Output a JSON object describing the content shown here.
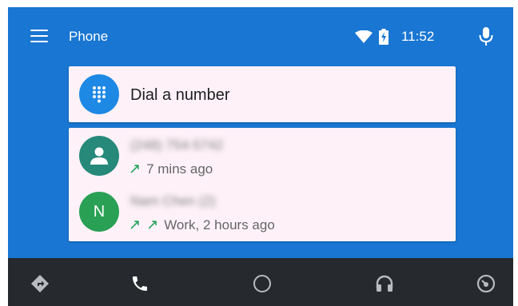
{
  "statusbar": {
    "app_title": "Phone",
    "time": "11:52"
  },
  "dial": {
    "label": "Dial a number"
  },
  "recents": [
    {
      "name": "(248) 754-5742",
      "avatar": "person-icon",
      "arrows": [
        "↗"
      ],
      "detail": "7 mins ago"
    },
    {
      "name": "Nam Chen (2)",
      "avatar_letter": "N",
      "arrows": [
        "↗",
        "↗"
      ],
      "detail": "Work, 2 hours ago"
    }
  ],
  "colors": {
    "app_bar": "#1976d2",
    "card": "#fef2f8",
    "dial_circle": "#1e88e5",
    "avatar_teal": "#26897a",
    "avatar_green": "#2aa055",
    "outgoing_arrow": "#1a9e55",
    "nav_bar": "#262a2e"
  },
  "navbar": {
    "items": [
      "navigation-icon",
      "phone-icon",
      "home-icon",
      "headphones-icon",
      "dashboard-icon"
    ],
    "active": "phone-icon"
  }
}
